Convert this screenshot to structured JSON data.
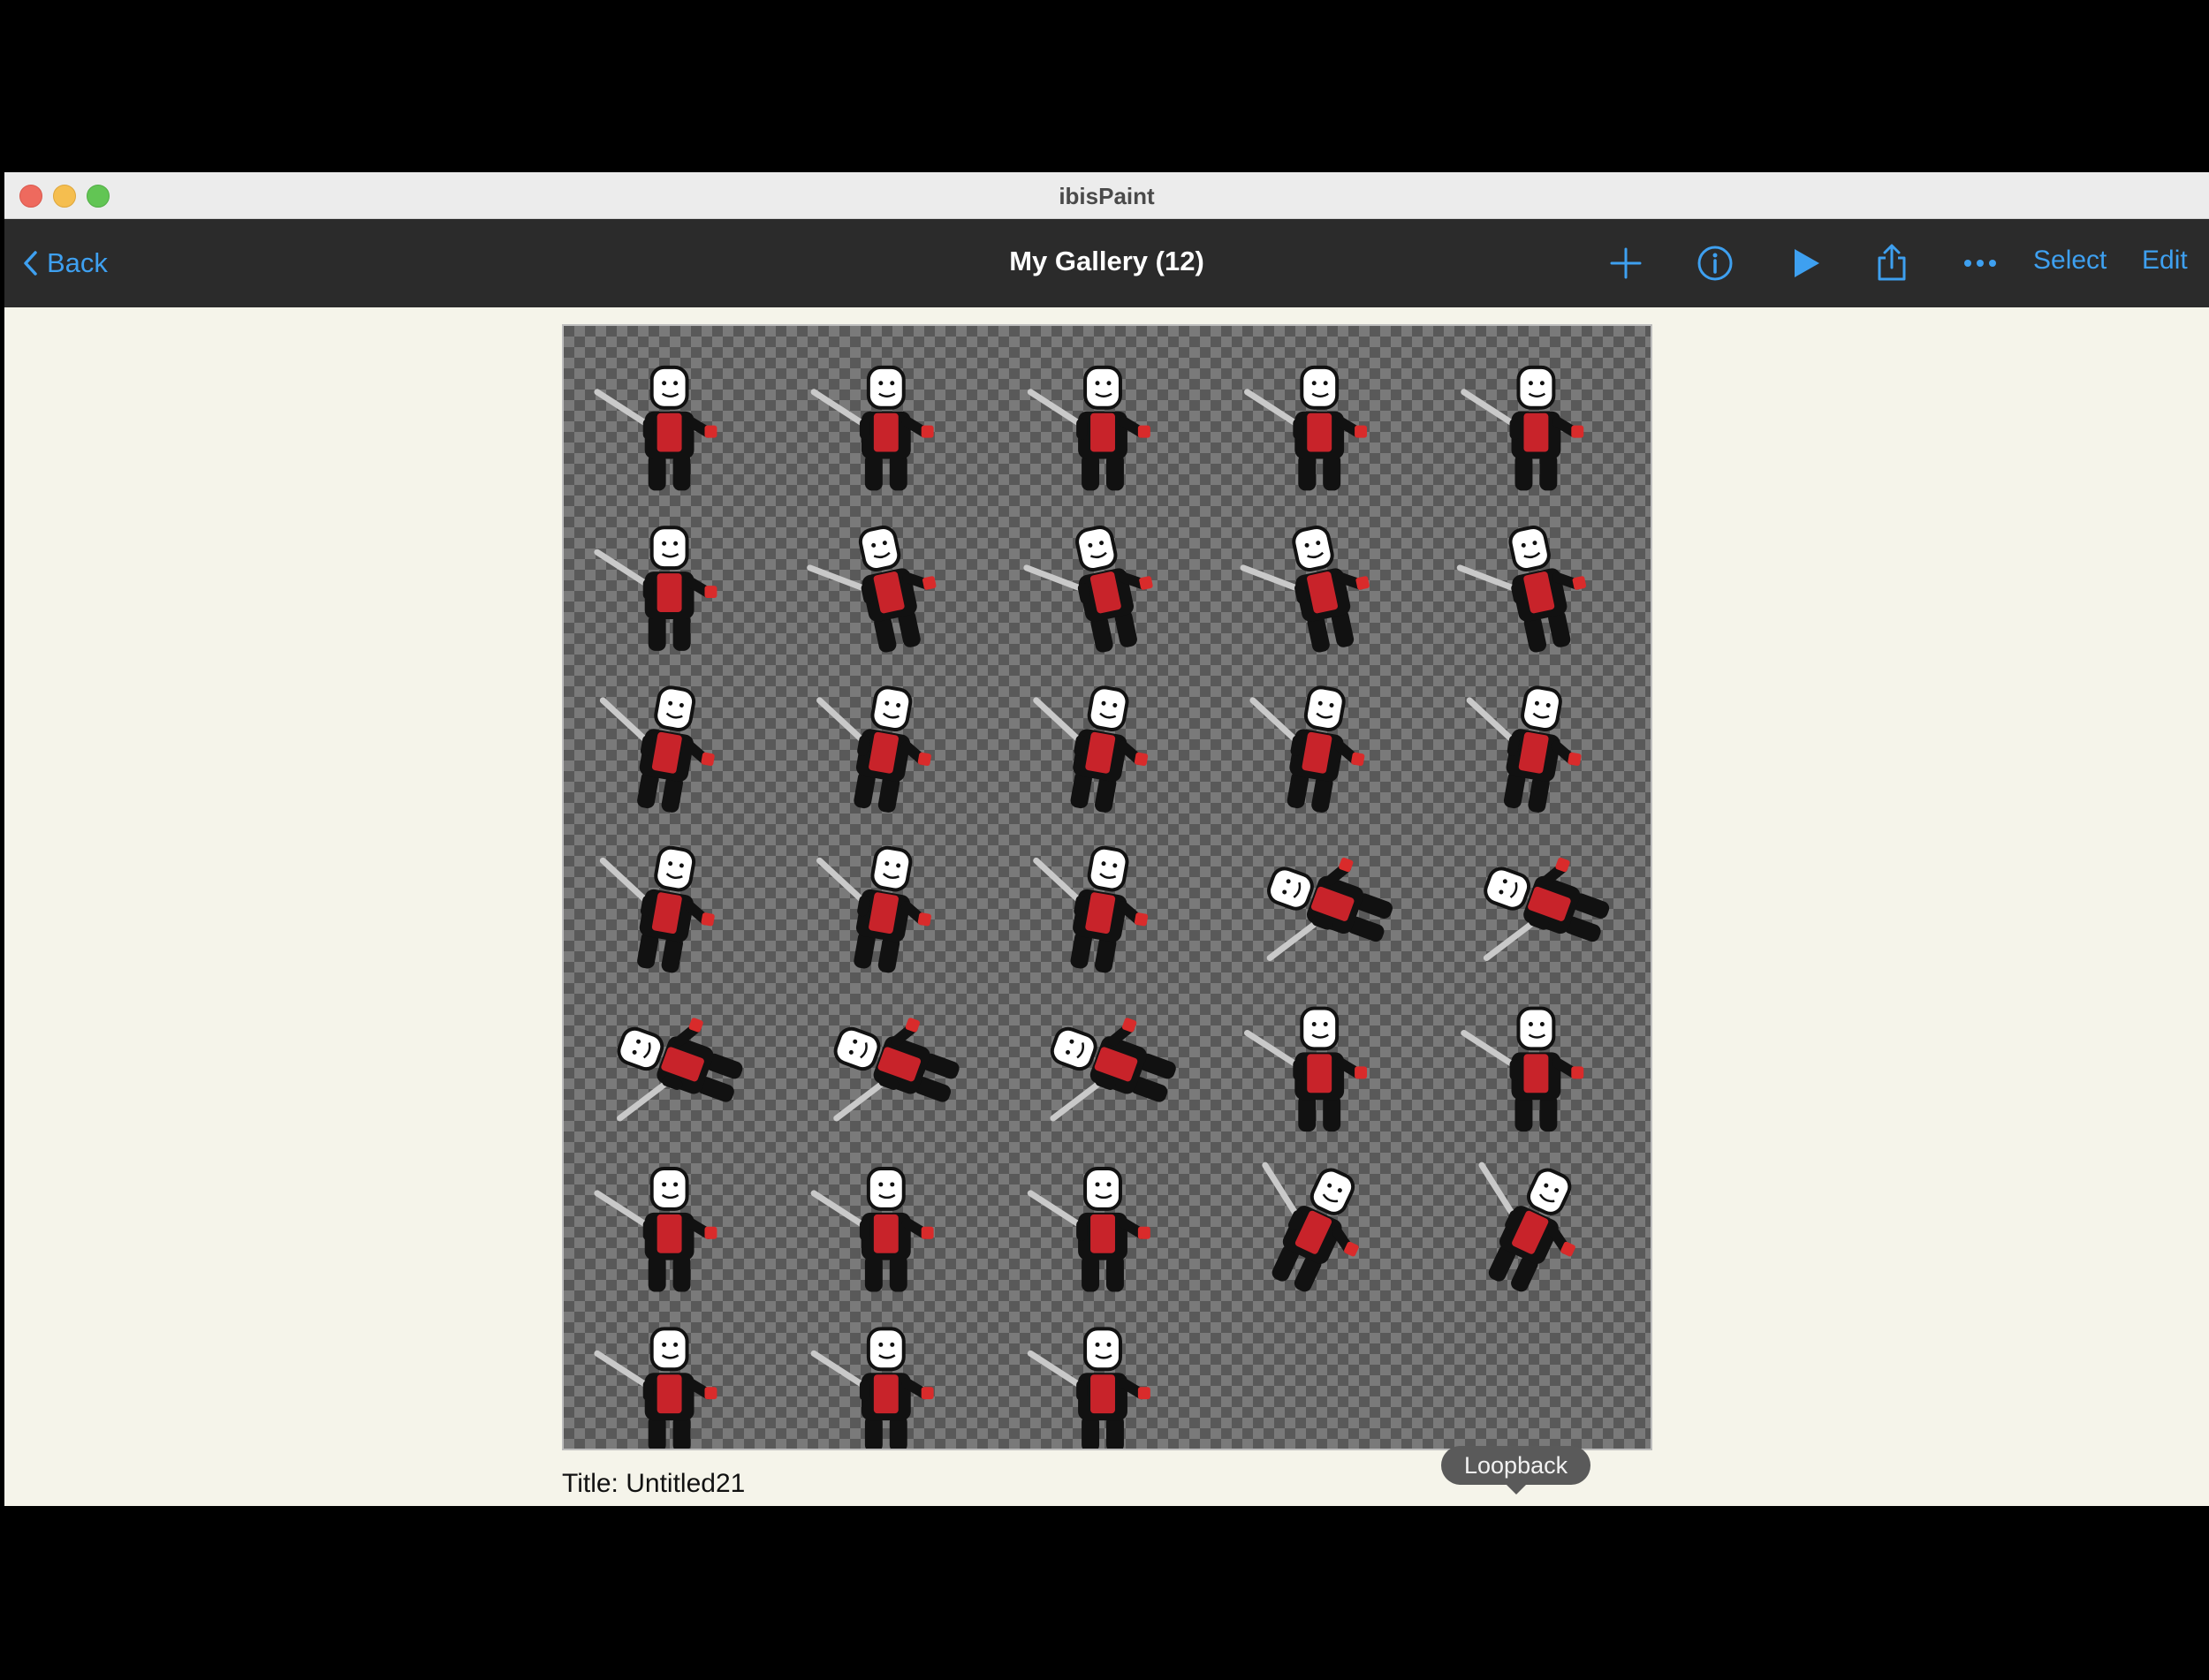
{
  "window": {
    "title": "ibisPaint"
  },
  "toolbar": {
    "back_label": "Back",
    "gallery_title": "My Gallery (12)",
    "select_label": "Select",
    "edit_label": "Edit",
    "icons": [
      "add-icon",
      "info-icon",
      "play-icon",
      "share-icon",
      "more-icon"
    ],
    "accent_color": "#3ea0f0"
  },
  "artwork": {
    "title_line": "Title: Untitled21",
    "frames": [
      {
        "pose": "idle"
      },
      {
        "pose": "idle"
      },
      {
        "pose": "idle"
      },
      {
        "pose": "idle"
      },
      {
        "pose": "idle"
      },
      {
        "pose": "idle"
      },
      {
        "pose": "swing"
      },
      {
        "pose": "swing"
      },
      {
        "pose": "swing"
      },
      {
        "pose": "swing"
      },
      {
        "pose": "raise"
      },
      {
        "pose": "raise"
      },
      {
        "pose": "raise"
      },
      {
        "pose": "raise"
      },
      {
        "pose": "raise"
      },
      {
        "pose": "raise"
      },
      {
        "pose": "raise"
      },
      {
        "pose": "raise"
      },
      {
        "pose": "dive"
      },
      {
        "pose": "dive"
      },
      {
        "pose": "dive"
      },
      {
        "pose": "dive"
      },
      {
        "pose": "dive"
      },
      {
        "pose": "idle"
      },
      {
        "pose": "idle"
      },
      {
        "pose": "idle"
      },
      {
        "pose": "idle"
      },
      {
        "pose": "idle"
      },
      {
        "pose": "lunge"
      },
      {
        "pose": "lunge"
      },
      {
        "pose": "crouch"
      },
      {
        "pose": "crouch"
      },
      {
        "pose": "crouch"
      }
    ]
  },
  "tooltip": {
    "label": "Loopback"
  }
}
